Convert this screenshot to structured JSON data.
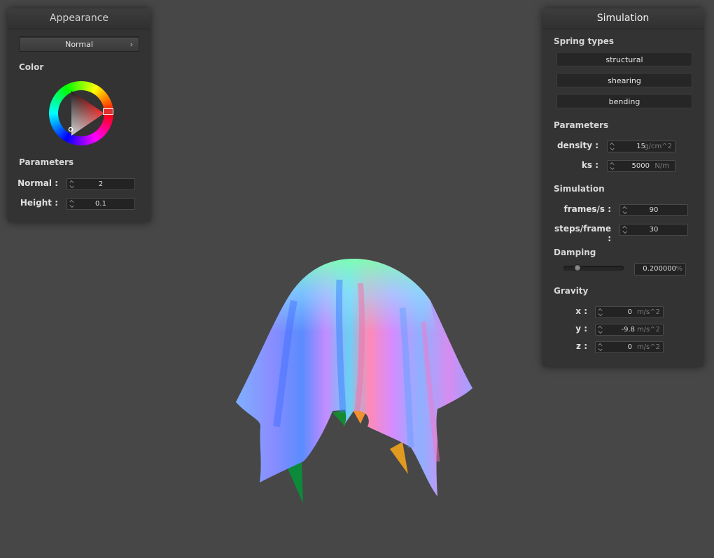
{
  "appearance": {
    "title": "Appearance",
    "shader_select": "Normal",
    "color_label": "Color",
    "parameters_label": "Parameters",
    "normal_label": "Normal :",
    "normal_value": "2",
    "height_label": "Height :",
    "height_value": "0.1"
  },
  "simulation_panel": {
    "title": "Simulation",
    "spring_types_label": "Spring types",
    "spring_buttons": [
      "structural",
      "shearing",
      "bending"
    ],
    "parameters_label": "Parameters",
    "density_label": "density :",
    "density_value": "15",
    "density_unit": "g/cm^2",
    "ks_label": "ks :",
    "ks_value": "5000",
    "ks_unit": "N/m",
    "simulation_label": "Simulation",
    "fps_label": "frames/s :",
    "fps_value": "90",
    "steps_label": "steps/frame :",
    "steps_value": "30",
    "damping_label": "Damping",
    "damping_value": "0.200000",
    "damping_unit": "%",
    "damping_fraction": 0.2,
    "gravity_label": "Gravity",
    "gx_label": "x :",
    "gx_value": "0",
    "gy_label": "y :",
    "gy_value": "-9.8",
    "gz_label": "z :",
    "gz_value": "0",
    "gravity_unit": "m/s^2"
  },
  "colors": {
    "background": "#474747",
    "panel": "#333333",
    "picked_color": "#e03030"
  },
  "icons": {
    "select_arrow": "chevron-right-icon",
    "color_wheel": "color-wheel-icon"
  }
}
